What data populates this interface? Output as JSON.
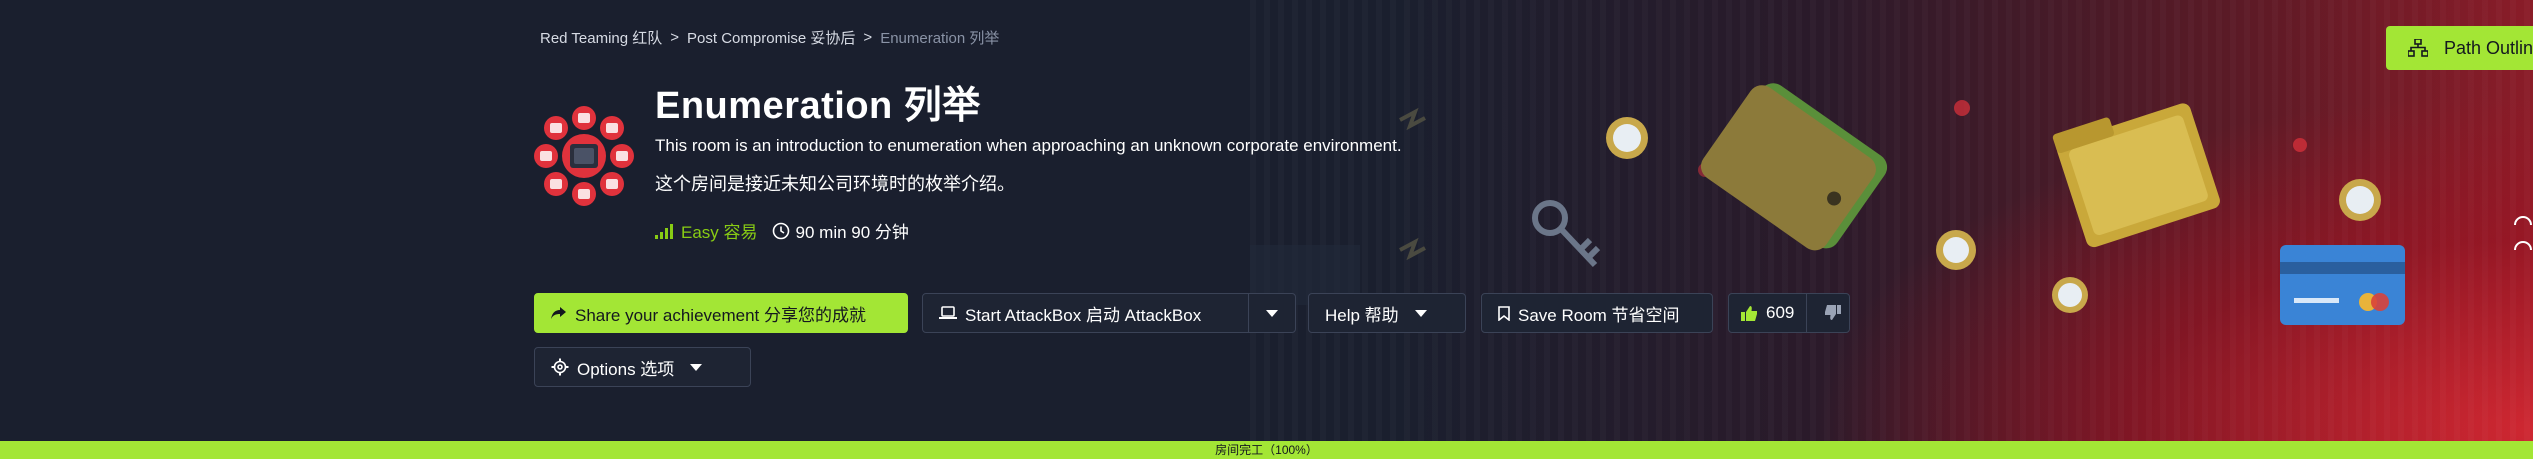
{
  "breadcrumb": {
    "item1": "Red Teaming 红队",
    "item2": "Post Compromise 妥协后",
    "current": "Enumeration 列举",
    "separator": ">"
  },
  "room": {
    "title": "Enumeration  列举",
    "description_en": "This room is an introduction to enumeration when approaching an unknown corporate environment.",
    "description_zh": "这个房间是接近未知公司环境时的枚举介绍。",
    "difficulty": "Easy 容易",
    "duration": "90 min 90 分钟"
  },
  "buttons": {
    "share": "Share your achievement  分享您的成就",
    "attackbox": "Start AttackBox  启动 AttackBox",
    "help": "Help  帮助",
    "save": "Save Room  节省空间",
    "likes": "609",
    "options": "Options  选项",
    "path_outline": "Path Outline"
  },
  "progress": {
    "label": "房间完工（100%）",
    "value": 100
  },
  "colors": {
    "accent": "#a3e635",
    "difficulty_green": "#88cc14",
    "background": "#1a1f2e",
    "hero_red": "#c8202d"
  },
  "icons": [
    "share-icon",
    "laptop-icon",
    "bookmark-icon",
    "thumbs-up-icon",
    "thumbs-down-icon",
    "gear-icon",
    "clock-icon",
    "signal-icon",
    "sitemap-icon"
  ]
}
